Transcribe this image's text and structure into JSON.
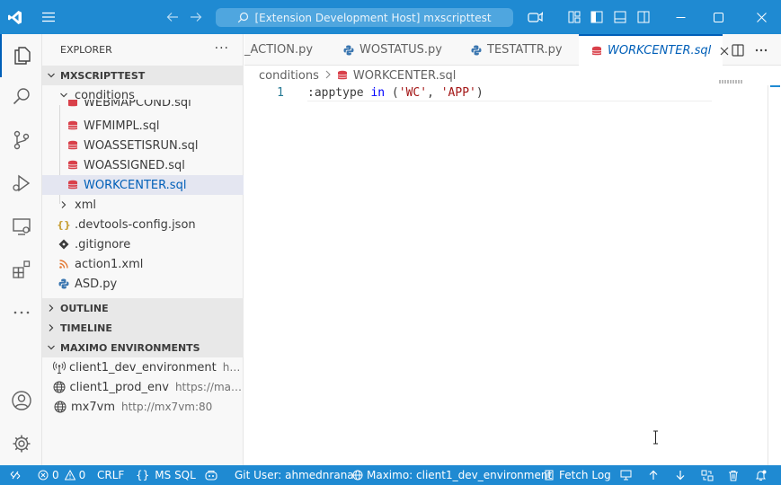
{
  "window": {
    "command_center_text": "[Extension Development Host] mxscripttest"
  },
  "sidebar": {
    "title": "EXPLORER",
    "more_label": "···",
    "workspace_folder": "MXSCRIPTTEST",
    "tree": {
      "conditions_folder": "conditions",
      "partial_file": "WEBMAPCOND.sql",
      "files": [
        "WFMIMPL.sql",
        "WOASSETISRUN.sql",
        "WOASSIGNED.sql",
        "WORKCENTER.sql"
      ],
      "xml_folder": "xml",
      "root_files": [
        ".devtools-config.json",
        ".gitignore",
        "action1.xml",
        "ASD.py"
      ]
    },
    "outline_label": "OUTLINE",
    "timeline_label": "TIMELINE",
    "maximo_label": "MAXIMO ENVIRONMENTS",
    "environments": [
      {
        "name": "client1_dev_environment",
        "url": "http..."
      },
      {
        "name": "client1_prod_env",
        "url": "https://maxi..."
      },
      {
        "name": "mx7vm",
        "url": "http://mx7vm:80"
      }
    ]
  },
  "tabs": [
    {
      "label": "_ACTION.py"
    },
    {
      "label": "WOSTATUS.py"
    },
    {
      "label": "TESTATTR.py"
    },
    {
      "label": "WORKCENTER.sql"
    }
  ],
  "breadcrumb": {
    "folder": "conditions",
    "file": "WORKCENTER.sql"
  },
  "editor": {
    "line_number": "1",
    "tokens": {
      "ident": ":apptype ",
      "keyword": "in",
      "open": " (",
      "str1": "'WC'",
      "comma": ", ",
      "str2": "'APP'",
      "close": ")"
    }
  },
  "statusbar": {
    "errors": "0",
    "warnings": "0",
    "eol": "CRLF",
    "language": "MS SQL",
    "git_user": "Git User: ahmednrana",
    "maximo_env": "Maximo: client1_dev_environment",
    "fetch_log": "Fetch Log"
  },
  "colors": {
    "titlebar": "#1f8ad2",
    "statusbar": "#1f8ad2",
    "accent": "#005fb8",
    "sql_icon": "#d9404a"
  }
}
